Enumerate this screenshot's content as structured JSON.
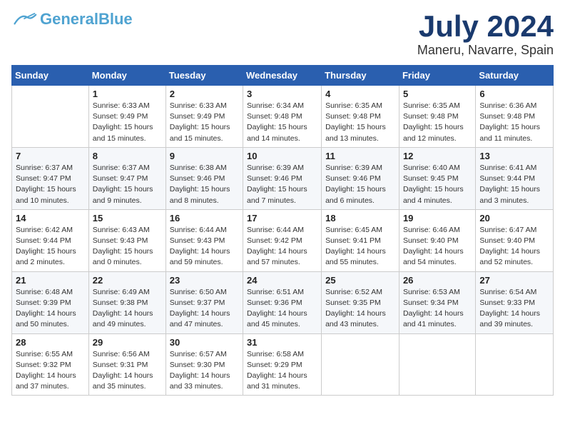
{
  "logo": {
    "text_general": "General",
    "text_blue": "Blue"
  },
  "title": "July 2024",
  "location": "Maneru, Navarre, Spain",
  "days_of_week": [
    "Sunday",
    "Monday",
    "Tuesday",
    "Wednesday",
    "Thursday",
    "Friday",
    "Saturday"
  ],
  "weeks": [
    [
      {
        "day": "",
        "info": ""
      },
      {
        "day": "1",
        "info": "Sunrise: 6:33 AM\nSunset: 9:49 PM\nDaylight: 15 hours and 15 minutes."
      },
      {
        "day": "2",
        "info": "Sunrise: 6:33 AM\nSunset: 9:49 PM\nDaylight: 15 hours and 15 minutes."
      },
      {
        "day": "3",
        "info": "Sunrise: 6:34 AM\nSunset: 9:48 PM\nDaylight: 15 hours and 14 minutes."
      },
      {
        "day": "4",
        "info": "Sunrise: 6:35 AM\nSunset: 9:48 PM\nDaylight: 15 hours and 13 minutes."
      },
      {
        "day": "5",
        "info": "Sunrise: 6:35 AM\nSunset: 9:48 PM\nDaylight: 15 hours and 12 minutes."
      },
      {
        "day": "6",
        "info": "Sunrise: 6:36 AM\nSunset: 9:48 PM\nDaylight: 15 hours and 11 minutes."
      }
    ],
    [
      {
        "day": "7",
        "info": "Sunrise: 6:37 AM\nSunset: 9:47 PM\nDaylight: 15 hours and 10 minutes."
      },
      {
        "day": "8",
        "info": "Sunrise: 6:37 AM\nSunset: 9:47 PM\nDaylight: 15 hours and 9 minutes."
      },
      {
        "day": "9",
        "info": "Sunrise: 6:38 AM\nSunset: 9:46 PM\nDaylight: 15 hours and 8 minutes."
      },
      {
        "day": "10",
        "info": "Sunrise: 6:39 AM\nSunset: 9:46 PM\nDaylight: 15 hours and 7 minutes."
      },
      {
        "day": "11",
        "info": "Sunrise: 6:39 AM\nSunset: 9:46 PM\nDaylight: 15 hours and 6 minutes."
      },
      {
        "day": "12",
        "info": "Sunrise: 6:40 AM\nSunset: 9:45 PM\nDaylight: 15 hours and 4 minutes."
      },
      {
        "day": "13",
        "info": "Sunrise: 6:41 AM\nSunset: 9:44 PM\nDaylight: 15 hours and 3 minutes."
      }
    ],
    [
      {
        "day": "14",
        "info": "Sunrise: 6:42 AM\nSunset: 9:44 PM\nDaylight: 15 hours and 2 minutes."
      },
      {
        "day": "15",
        "info": "Sunrise: 6:43 AM\nSunset: 9:43 PM\nDaylight: 15 hours and 0 minutes."
      },
      {
        "day": "16",
        "info": "Sunrise: 6:44 AM\nSunset: 9:43 PM\nDaylight: 14 hours and 59 minutes."
      },
      {
        "day": "17",
        "info": "Sunrise: 6:44 AM\nSunset: 9:42 PM\nDaylight: 14 hours and 57 minutes."
      },
      {
        "day": "18",
        "info": "Sunrise: 6:45 AM\nSunset: 9:41 PM\nDaylight: 14 hours and 55 minutes."
      },
      {
        "day": "19",
        "info": "Sunrise: 6:46 AM\nSunset: 9:40 PM\nDaylight: 14 hours and 54 minutes."
      },
      {
        "day": "20",
        "info": "Sunrise: 6:47 AM\nSunset: 9:40 PM\nDaylight: 14 hours and 52 minutes."
      }
    ],
    [
      {
        "day": "21",
        "info": "Sunrise: 6:48 AM\nSunset: 9:39 PM\nDaylight: 14 hours and 50 minutes."
      },
      {
        "day": "22",
        "info": "Sunrise: 6:49 AM\nSunset: 9:38 PM\nDaylight: 14 hours and 49 minutes."
      },
      {
        "day": "23",
        "info": "Sunrise: 6:50 AM\nSunset: 9:37 PM\nDaylight: 14 hours and 47 minutes."
      },
      {
        "day": "24",
        "info": "Sunrise: 6:51 AM\nSunset: 9:36 PM\nDaylight: 14 hours and 45 minutes."
      },
      {
        "day": "25",
        "info": "Sunrise: 6:52 AM\nSunset: 9:35 PM\nDaylight: 14 hours and 43 minutes."
      },
      {
        "day": "26",
        "info": "Sunrise: 6:53 AM\nSunset: 9:34 PM\nDaylight: 14 hours and 41 minutes."
      },
      {
        "day": "27",
        "info": "Sunrise: 6:54 AM\nSunset: 9:33 PM\nDaylight: 14 hours and 39 minutes."
      }
    ],
    [
      {
        "day": "28",
        "info": "Sunrise: 6:55 AM\nSunset: 9:32 PM\nDaylight: 14 hours and 37 minutes."
      },
      {
        "day": "29",
        "info": "Sunrise: 6:56 AM\nSunset: 9:31 PM\nDaylight: 14 hours and 35 minutes."
      },
      {
        "day": "30",
        "info": "Sunrise: 6:57 AM\nSunset: 9:30 PM\nDaylight: 14 hours and 33 minutes."
      },
      {
        "day": "31",
        "info": "Sunrise: 6:58 AM\nSunset: 9:29 PM\nDaylight: 14 hours and 31 minutes."
      },
      {
        "day": "",
        "info": ""
      },
      {
        "day": "",
        "info": ""
      },
      {
        "day": "",
        "info": ""
      }
    ]
  ]
}
